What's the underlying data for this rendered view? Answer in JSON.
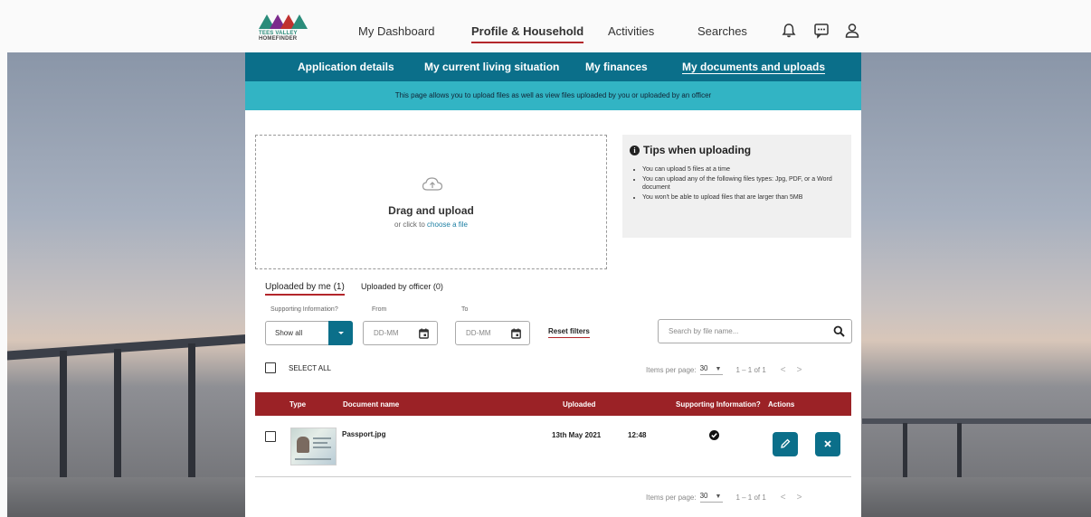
{
  "brand": {
    "logo_text_line1": "TEES VALLEY",
    "logo_text_line2": "HOMEFINDER"
  },
  "topnav": {
    "items": [
      {
        "label": "My Dashboard",
        "active": false
      },
      {
        "label": "Profile & Household",
        "active": true
      },
      {
        "label": "Activities",
        "active": false
      },
      {
        "label": "Searches",
        "active": false
      }
    ],
    "icons": [
      "bell-icon",
      "message-icon",
      "user-icon"
    ]
  },
  "subnav": {
    "items": [
      {
        "label": "Application details",
        "active": false
      },
      {
        "label": "My current living situation",
        "active": false
      },
      {
        "label": "My finances",
        "active": false
      },
      {
        "label": "My documents and uploads",
        "active": true
      }
    ]
  },
  "info_banner": "This page allows you to upload files as well as view files uploaded by you or uploaded by an officer",
  "upload": {
    "title": "Drag and upload",
    "subtitle_prefix": "or click to",
    "subtitle_link": "choose a file"
  },
  "tips": {
    "title": "Tips when uploading",
    "items": [
      "You can upload 5 files at a time",
      "You can upload any of the following files types: Jpg, PDF, or a Word document",
      "You won't be able to upload files that are larger than 5MB"
    ]
  },
  "tabs": [
    {
      "label": "Uploaded by me (1)",
      "active": true
    },
    {
      "label": "Uploaded by officer (0)",
      "active": false
    }
  ],
  "filters": {
    "supporting_label": "Supporting Information?",
    "supporting_value": "Show all",
    "from_label": "From",
    "to_label": "To",
    "date_placeholder": "DD-MM",
    "reset_label": "Reset filters",
    "search_placeholder": "Search by file name..."
  },
  "select_all_label": "SELECT ALL",
  "pagination": {
    "items_per_page_label": "Items per page:",
    "items_per_page": "30",
    "range": "1 – 1 of 1",
    "prev": "<",
    "next": ">"
  },
  "table": {
    "columns": [
      "Type",
      "Document name",
      "Uploaded",
      "Supporting Information?",
      "Actions"
    ],
    "rows": [
      {
        "document_name": "Passport.jpg",
        "uploaded_date": "13th May 2021",
        "uploaded_time": "12:48",
        "supporting_information": true
      }
    ]
  },
  "colors": {
    "teal_nav": "#0b6f8a",
    "info_banner": "#32b4c4",
    "table_header": "#9b2226",
    "accent_underline": "#b3262b"
  }
}
